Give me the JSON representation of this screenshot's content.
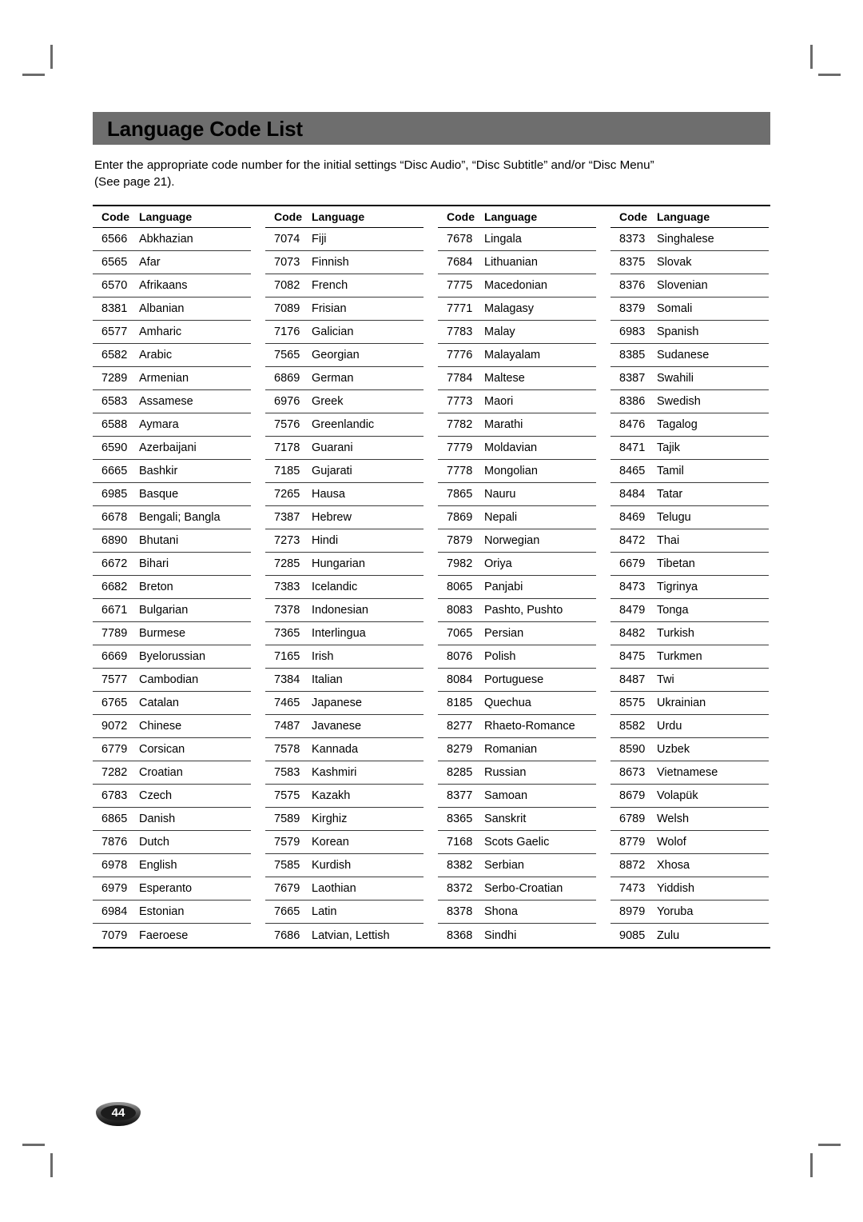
{
  "document": {
    "title": "Language Code List",
    "intro_line1": "Enter the appropriate code number for the initial settings “Disc Audio”, “Disc Subtitle” and/or “Disc Menu”",
    "intro_line2": "(See page 21).",
    "page_number": "44",
    "title_bar_color": "#6e6e6e",
    "title_text_color": "#000000",
    "page_background": "#ffffff",
    "rule_color": "#000000"
  },
  "table": {
    "headers": {
      "code": "Code",
      "language": "Language"
    },
    "columns": [
      {
        "rows": [
          {
            "code": "6566",
            "language": "Abkhazian"
          },
          {
            "code": "6565",
            "language": "Afar"
          },
          {
            "code": "6570",
            "language": "Afrikaans"
          },
          {
            "code": "8381",
            "language": "Albanian"
          },
          {
            "code": "6577",
            "language": "Amharic"
          },
          {
            "code": "6582",
            "language": "Arabic"
          },
          {
            "code": "7289",
            "language": "Armenian"
          },
          {
            "code": "6583",
            "language": "Assamese"
          },
          {
            "code": "6588",
            "language": "Aymara"
          },
          {
            "code": "6590",
            "language": "Azerbaijani"
          },
          {
            "code": "6665",
            "language": "Bashkir"
          },
          {
            "code": "6985",
            "language": "Basque"
          },
          {
            "code": "6678",
            "language": "Bengali; Bangla"
          },
          {
            "code": "6890",
            "language": "Bhutani"
          },
          {
            "code": "6672",
            "language": "Bihari"
          },
          {
            "code": "6682",
            "language": "Breton"
          },
          {
            "code": "6671",
            "language": "Bulgarian"
          },
          {
            "code": "7789",
            "language": "Burmese"
          },
          {
            "code": "6669",
            "language": "Byelorussian"
          },
          {
            "code": "7577",
            "language": "Cambodian"
          },
          {
            "code": "6765",
            "language": "Catalan"
          },
          {
            "code": "9072",
            "language": "Chinese"
          },
          {
            "code": "6779",
            "language": "Corsican"
          },
          {
            "code": "7282",
            "language": "Croatian"
          },
          {
            "code": "6783",
            "language": "Czech"
          },
          {
            "code": "6865",
            "language": "Danish"
          },
          {
            "code": "7876",
            "language": "Dutch"
          },
          {
            "code": "6978",
            "language": "English"
          },
          {
            "code": "6979",
            "language": "Esperanto"
          },
          {
            "code": "6984",
            "language": "Estonian"
          },
          {
            "code": "7079",
            "language": "Faeroese"
          }
        ]
      },
      {
        "rows": [
          {
            "code": "7074",
            "language": "Fiji"
          },
          {
            "code": "7073",
            "language": "Finnish"
          },
          {
            "code": "7082",
            "language": "French"
          },
          {
            "code": "7089",
            "language": "Frisian"
          },
          {
            "code": "7176",
            "language": "Galician"
          },
          {
            "code": "7565",
            "language": "Georgian"
          },
          {
            "code": "6869",
            "language": "German"
          },
          {
            "code": "6976",
            "language": "Greek"
          },
          {
            "code": "7576",
            "language": "Greenlandic"
          },
          {
            "code": "7178",
            "language": "Guarani"
          },
          {
            "code": "7185",
            "language": "Gujarati"
          },
          {
            "code": "7265",
            "language": "Hausa"
          },
          {
            "code": "7387",
            "language": "Hebrew"
          },
          {
            "code": "7273",
            "language": "Hindi"
          },
          {
            "code": "7285",
            "language": "Hungarian"
          },
          {
            "code": "7383",
            "language": "Icelandic"
          },
          {
            "code": "7378",
            "language": "Indonesian"
          },
          {
            "code": "7365",
            "language": "Interlingua"
          },
          {
            "code": "7165",
            "language": "Irish"
          },
          {
            "code": "7384",
            "language": "Italian"
          },
          {
            "code": "7465",
            "language": "Japanese"
          },
          {
            "code": "7487",
            "language": "Javanese"
          },
          {
            "code": "7578",
            "language": "Kannada"
          },
          {
            "code": "7583",
            "language": "Kashmiri"
          },
          {
            "code": "7575",
            "language": "Kazakh"
          },
          {
            "code": "7589",
            "language": "Kirghiz"
          },
          {
            "code": "7579",
            "language": "Korean"
          },
          {
            "code": "7585",
            "language": "Kurdish"
          },
          {
            "code": "7679",
            "language": "Laothian"
          },
          {
            "code": "7665",
            "language": "Latin"
          },
          {
            "code": "7686",
            "language": "Latvian, Lettish"
          }
        ]
      },
      {
        "rows": [
          {
            "code": "7678",
            "language": "Lingala"
          },
          {
            "code": "7684",
            "language": "Lithuanian"
          },
          {
            "code": "7775",
            "language": "Macedonian"
          },
          {
            "code": "7771",
            "language": "Malagasy"
          },
          {
            "code": "7783",
            "language": "Malay"
          },
          {
            "code": "7776",
            "language": "Malayalam"
          },
          {
            "code": "7784",
            "language": "Maltese"
          },
          {
            "code": "7773",
            "language": "Maori"
          },
          {
            "code": "7782",
            "language": "Marathi"
          },
          {
            "code": "7779",
            "language": "Moldavian"
          },
          {
            "code": "7778",
            "language": "Mongolian"
          },
          {
            "code": "7865",
            "language": "Nauru"
          },
          {
            "code": "7869",
            "language": "Nepali"
          },
          {
            "code": "7879",
            "language": "Norwegian"
          },
          {
            "code": "7982",
            "language": "Oriya"
          },
          {
            "code": "8065",
            "language": "Panjabi"
          },
          {
            "code": "8083",
            "language": "Pashto, Pushto"
          },
          {
            "code": "7065",
            "language": "Persian"
          },
          {
            "code": "8076",
            "language": "Polish"
          },
          {
            "code": "8084",
            "language": "Portuguese"
          },
          {
            "code": "8185",
            "language": "Quechua"
          },
          {
            "code": "8277",
            "language": "Rhaeto-Romance"
          },
          {
            "code": "8279",
            "language": "Romanian"
          },
          {
            "code": "8285",
            "language": "Russian"
          },
          {
            "code": "8377",
            "language": "Samoan"
          },
          {
            "code": "8365",
            "language": "Sanskrit"
          },
          {
            "code": "7168",
            "language": "Scots Gaelic"
          },
          {
            "code": "8382",
            "language": "Serbian"
          },
          {
            "code": "8372",
            "language": "Serbo-Croatian"
          },
          {
            "code": "8378",
            "language": "Shona"
          },
          {
            "code": "8368",
            "language": "Sindhi"
          }
        ]
      },
      {
        "rows": [
          {
            "code": "8373",
            "language": "Singhalese"
          },
          {
            "code": "8375",
            "language": "Slovak"
          },
          {
            "code": "8376",
            "language": "Slovenian"
          },
          {
            "code": "8379",
            "language": "Somali"
          },
          {
            "code": "6983",
            "language": "Spanish"
          },
          {
            "code": "8385",
            "language": "Sudanese"
          },
          {
            "code": "8387",
            "language": "Swahili"
          },
          {
            "code": "8386",
            "language": "Swedish"
          },
          {
            "code": "8476",
            "language": "Tagalog"
          },
          {
            "code": "8471",
            "language": "Tajik"
          },
          {
            "code": "8465",
            "language": "Tamil"
          },
          {
            "code": "8484",
            "language": "Tatar"
          },
          {
            "code": "8469",
            "language": "Telugu"
          },
          {
            "code": "8472",
            "language": "Thai"
          },
          {
            "code": "6679",
            "language": "Tibetan"
          },
          {
            "code": "8473",
            "language": "Tigrinya"
          },
          {
            "code": "8479",
            "language": "Tonga"
          },
          {
            "code": "8482",
            "language": "Turkish"
          },
          {
            "code": "8475",
            "language": "Turkmen"
          },
          {
            "code": "8487",
            "language": "Twi"
          },
          {
            "code": "8575",
            "language": "Ukrainian"
          },
          {
            "code": "8582",
            "language": "Urdu"
          },
          {
            "code": "8590",
            "language": "Uzbek"
          },
          {
            "code": "8673",
            "language": "Vietnamese"
          },
          {
            "code": "8679",
            "language": "Volapük"
          },
          {
            "code": "6789",
            "language": "Welsh"
          },
          {
            "code": "8779",
            "language": "Wolof"
          },
          {
            "code": "8872",
            "language": "Xhosa"
          },
          {
            "code": "7473",
            "language": "Yiddish"
          },
          {
            "code": "8979",
            "language": "Yoruba"
          },
          {
            "code": "9085",
            "language": "Zulu"
          }
        ]
      }
    ]
  }
}
